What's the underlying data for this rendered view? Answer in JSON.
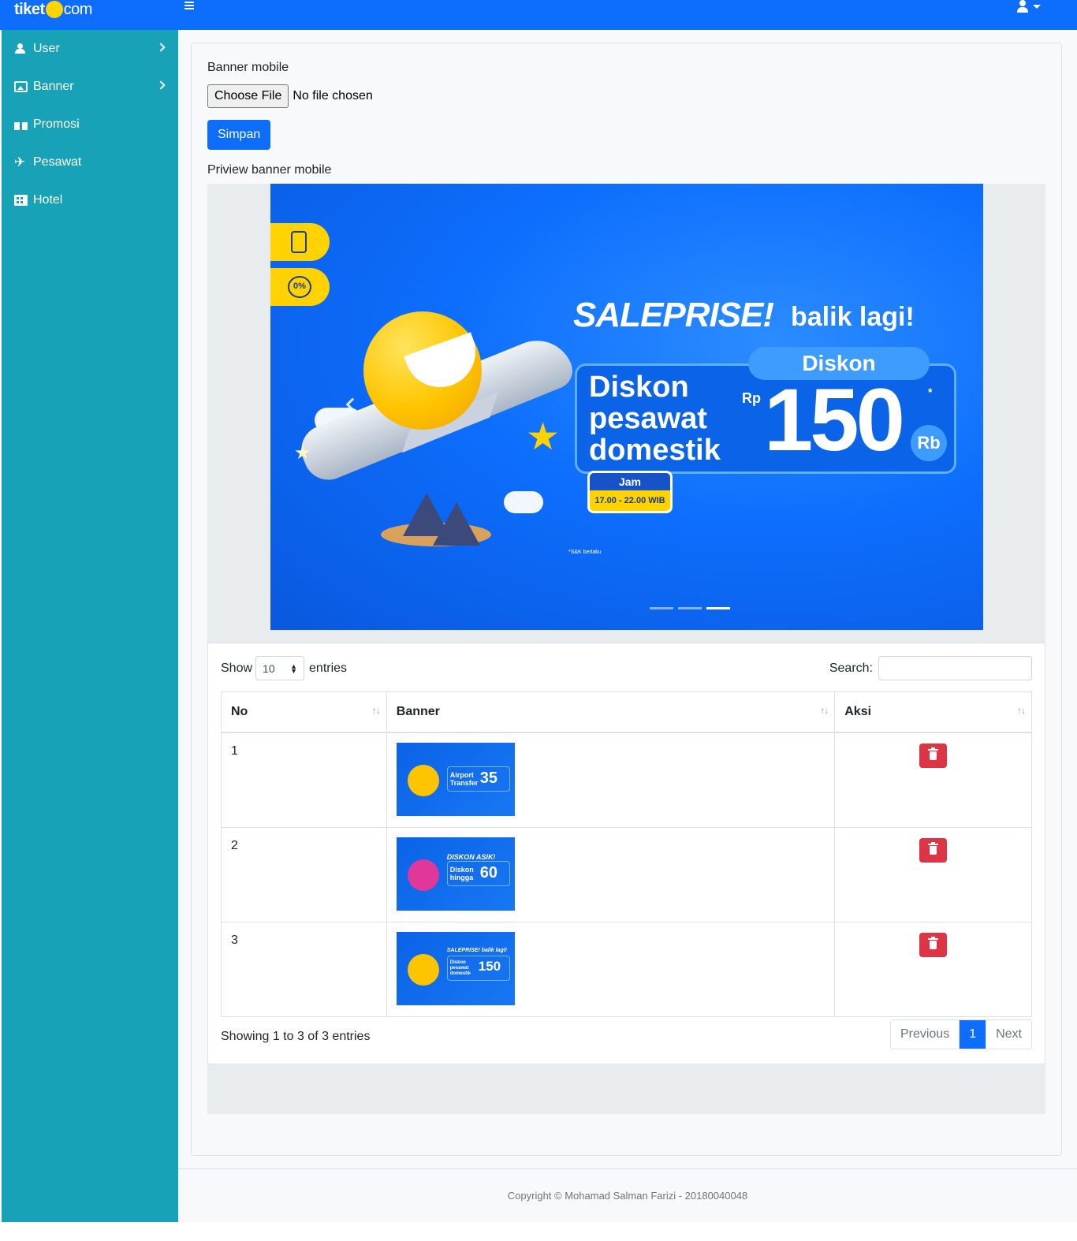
{
  "brand": {
    "logo_left": "tiket",
    "logo_right": "com"
  },
  "navbar": {
    "menu_icon": "hamburger-icon",
    "user_icon": "user-icon"
  },
  "sidebar": {
    "items": [
      {
        "label": "User",
        "icon": "user-icon",
        "has_submenu": true
      },
      {
        "label": "Banner",
        "icon": "image-icon",
        "has_submenu": true
      },
      {
        "label": "Promosi",
        "icon": "gift-icon",
        "has_submenu": false
      },
      {
        "label": "Pesawat",
        "icon": "plane-icon",
        "has_submenu": false
      },
      {
        "label": "Hotel",
        "icon": "hotel-icon",
        "has_submenu": false
      }
    ]
  },
  "form": {
    "field_label": "Banner mobile",
    "file_button": "Choose File",
    "file_status": "No file chosen",
    "save_button": "Simpan",
    "preview_label": "Priview banner mobile"
  },
  "carousel": {
    "active_index": 3,
    "slide_count": 3,
    "slide": {
      "title": "SALEPRISE!",
      "subtitle": "balik lagi!",
      "pill": "Diskon",
      "headline": [
        "Diskon",
        "pesawat",
        "domestik"
      ],
      "currency": "Rp",
      "amount": "150",
      "unit": "Rb",
      "asterisk": "*",
      "jam_label": "Jam",
      "jam_time": "17.00 - 22.00 WIB",
      "note": "*S&K berlaku",
      "tab_icons": [
        "phone-icon",
        "percent-icon"
      ],
      "tab_percent": "0%"
    }
  },
  "datatable": {
    "show_label": "Show",
    "page_length": "10",
    "entries_label": "entries",
    "search_label": "Search:",
    "search_value": "",
    "columns": [
      "No",
      "Banner",
      "Aksi"
    ],
    "rows": [
      {
        "no": "1",
        "thumb_head": "",
        "thumb_text": "Airport Transfer",
        "thumb_num": "35"
      },
      {
        "no": "2",
        "thumb_head": "DISKON ASIK!",
        "thumb_text": "Diskon hingga",
        "thumb_num": "60"
      },
      {
        "no": "3",
        "thumb_head": "SALEPRISE! balik lagi!",
        "thumb_text": "Diskon pesawat domestik",
        "thumb_num": "150"
      }
    ],
    "info": "Showing 1 to 3 of 3 entries",
    "pager": {
      "previous": "Previous",
      "current": "1",
      "next": "Next"
    }
  },
  "footer": {
    "text": "Copyright © Mohamad Salman Farizi - 20180040048"
  },
  "colors": {
    "primary": "#0d6efd",
    "sidebar": "#17a2b8",
    "danger": "#dc3545",
    "accent_yellow": "#ffd200"
  }
}
